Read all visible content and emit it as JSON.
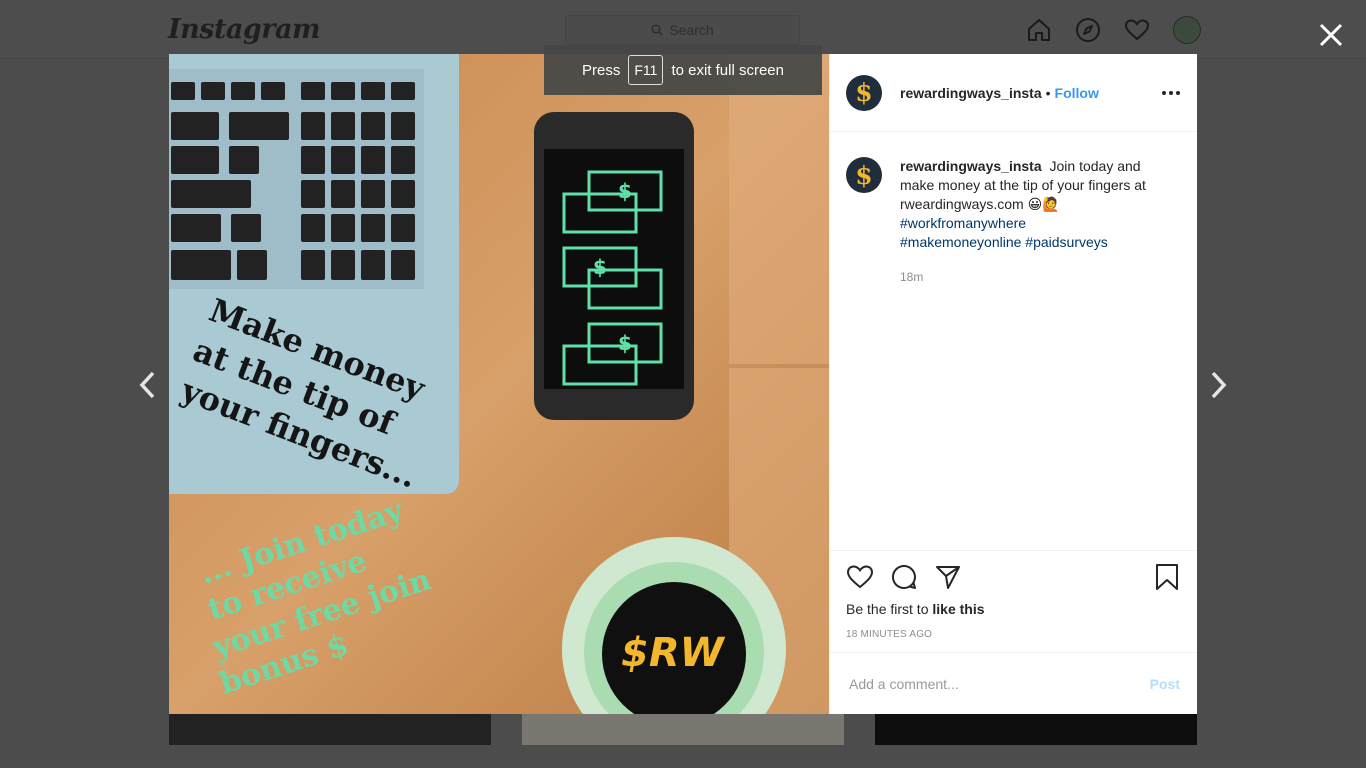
{
  "background": {
    "logo": "Instagram",
    "search_placeholder": "Search",
    "icons": [
      "home-icon",
      "explore-compass-icon",
      "activity-heart-icon"
    ]
  },
  "toast": {
    "press": "Press",
    "key": "F11",
    "suffix": "to exit full screen"
  },
  "image_overlay": {
    "headline_lines": [
      "Make money",
      "at the tip of",
      "your fingers..."
    ],
    "cta_lines": [
      "... Join today",
      "to receive",
      "your free join",
      "bonus $"
    ],
    "cup_logo": "$RW"
  },
  "post": {
    "username": "rewardingways_insta",
    "separator": "•",
    "follow_label": "Follow",
    "caption_text": "Join today and make money at the tip of your fingers at rweardingways.com 😀🙋",
    "hashtags": [
      "#workfromanywhere",
      "#makemoneyonline",
      "#paidsurveys"
    ],
    "caption_time": "18m",
    "likes_prefix": "Be the first to",
    "likes_action": "like this",
    "time_ago": "18 MINUTES AGO",
    "comment_placeholder": "Add a comment...",
    "post_label": "Post"
  },
  "colors": {
    "accent": "#3897f0",
    "post_disabled": "#b2dffc",
    "hashtag": "#00376b",
    "backdrop": "#4c4c4c"
  }
}
